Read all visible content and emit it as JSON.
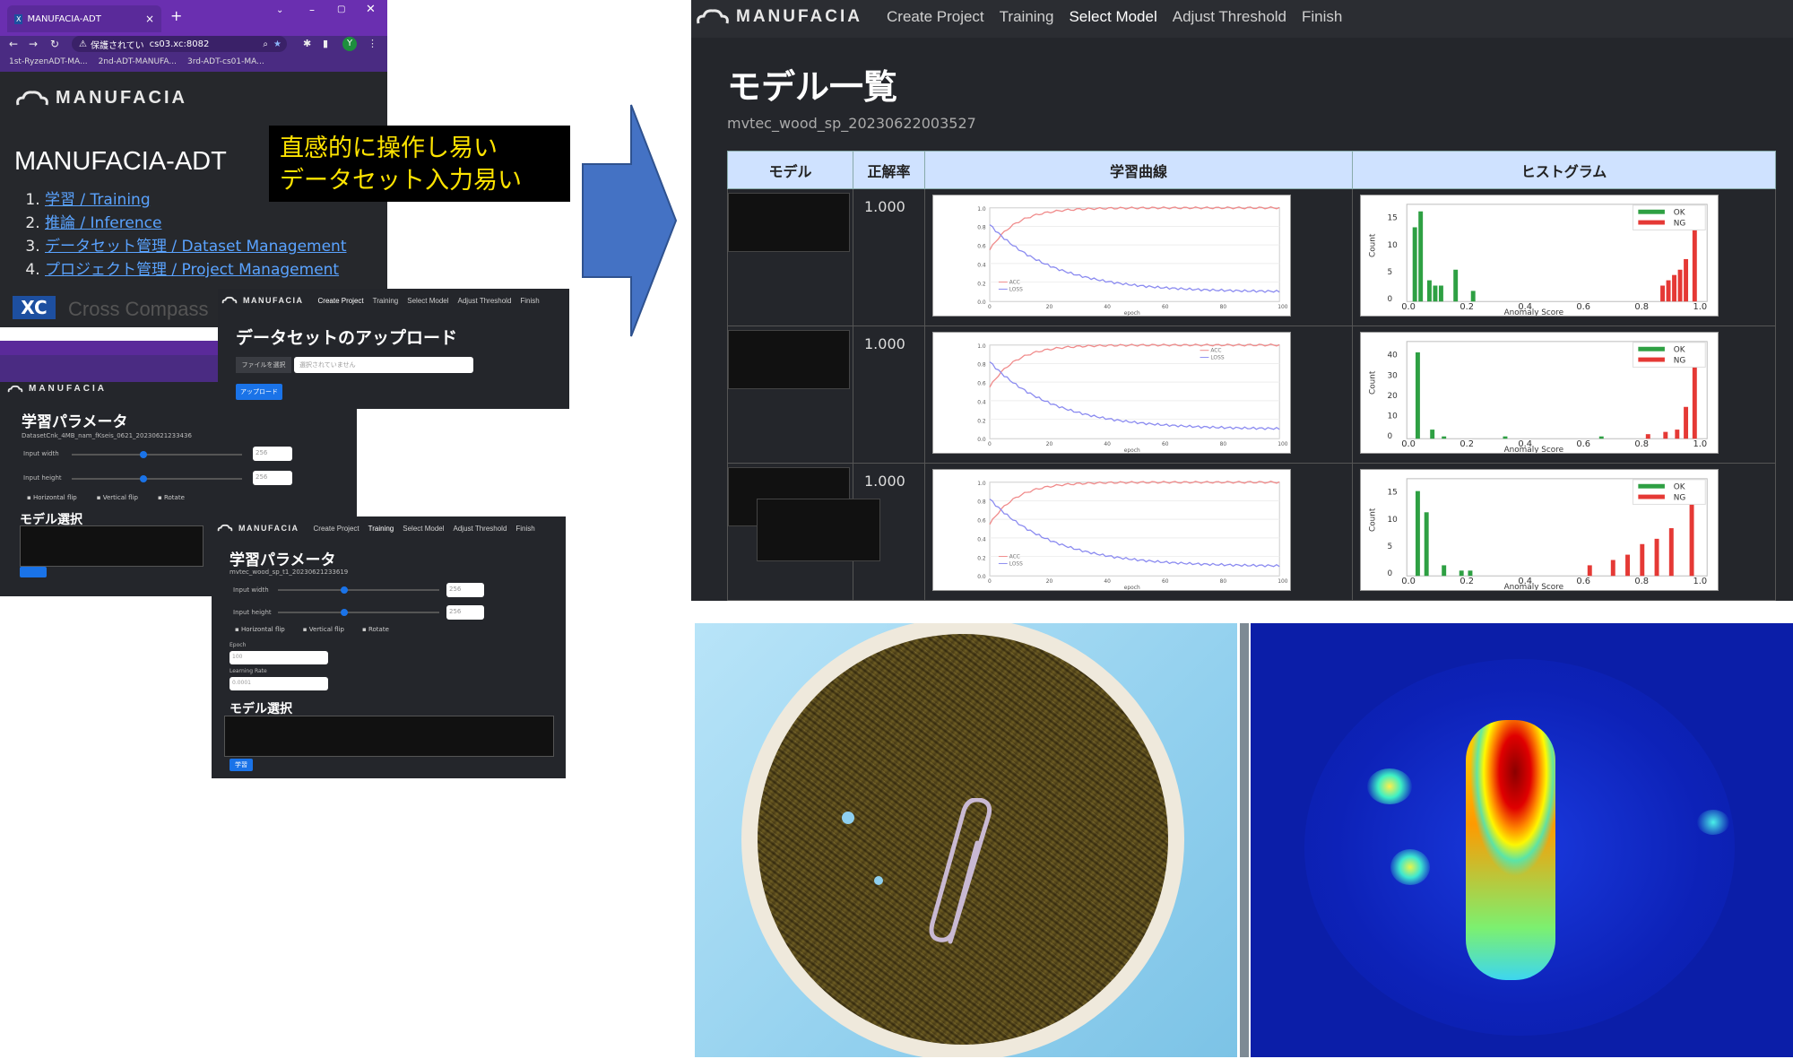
{
  "browser": {
    "tab_title": "MANUFACIA-ADT",
    "address": "cs03.xc:8082",
    "security_label": "保護されてい",
    "avatar_letter": "Y",
    "bookmarks": [
      "1st-RyzenADT-MA...",
      "2nd-ADT-MANUFA...",
      "3rd-ADT-cs01-MA..."
    ]
  },
  "home": {
    "logo": "MANUFACIA",
    "title": "MANUFACIA-ADT",
    "links": [
      "学習 / Training",
      "推論 / Inference",
      "データセット管理 / Dataset Management",
      "プロジェクト管理 / Project Management"
    ],
    "footer_logo": "XC",
    "footer_text": "Cross Compass"
  },
  "callout": {
    "line1": "直感的に操作し易い",
    "line2": "データセット入力易い"
  },
  "nav": {
    "logo": "MANUFACIA",
    "items": [
      "Create Project",
      "Training",
      "Select Model",
      "Adjust Threshold",
      "Finish"
    ]
  },
  "upload": {
    "title": "データセットのアップロード",
    "file_button": "ファイルを選択",
    "file_placeholder": "選択されていません",
    "upload_button": "アップロード"
  },
  "train1": {
    "title": "学習パラメータ",
    "dataset": "DatasetCnk_4MB_nam_fKseis_0621_20230621233436",
    "width_label": "Input width",
    "height_label": "Input height",
    "width_value": "256",
    "height_value": "256",
    "checks": [
      "Horizontal flip",
      "Vertical flip",
      "Rotate"
    ],
    "model_select": "モデル選択"
  },
  "train2": {
    "title": "学習パラメータ",
    "dataset": "mvtec_wood_sp_t1_20230621233619",
    "width_label": "Input width",
    "height_label": "Input height",
    "width_value": "256",
    "height_value": "256",
    "checks": [
      "Horizontal flip",
      "Vertical flip",
      "Rotate"
    ],
    "epoch_label": "Epoch",
    "epoch_value": "100",
    "lr_label": "Learning Rate",
    "lr_value": "0.0001",
    "model_select": "モデル選択",
    "learn_button": "学習"
  },
  "models": {
    "title": "モデル一覧",
    "dataset": "mvtec_wood_sp_20230622003527",
    "headers": [
      "モデル",
      "正解率",
      "学習曲線",
      "ヒストグラム"
    ],
    "rows": [
      {
        "accuracy": "1.000",
        "hist_ylabels": [
          "15",
          "10",
          "5",
          "0"
        ]
      },
      {
        "accuracy": "1.000",
        "hist_ylabels": [
          "40",
          "30",
          "20",
          "10",
          "0"
        ]
      },
      {
        "accuracy": "1.000",
        "hist_ylabels": [
          "15",
          "10",
          "5",
          "0"
        ]
      }
    ],
    "legend_curve": [
      "ACC",
      "LOSS"
    ],
    "legend_hist": [
      "OK",
      "NG"
    ],
    "curve_xlabel": "epoch",
    "hist_xlabel": "Anomaly Score",
    "hist_ylabel": "Count",
    "hist_xticks": [
      "0.0",
      "0.2",
      "0.4",
      "0.6",
      "0.8",
      "1.0"
    ],
    "curve_xticks": [
      "0",
      "20",
      "40",
      "60",
      "80",
      "100"
    ],
    "curve_yticks": [
      "1.0",
      "0.8",
      "0.6",
      "0.4",
      "0.2",
      "0.0"
    ]
  },
  "colors": {
    "ok": "#2ea043",
    "ng": "#e53935",
    "accent": "#1a73e8",
    "arrow": "#4472c4"
  }
}
